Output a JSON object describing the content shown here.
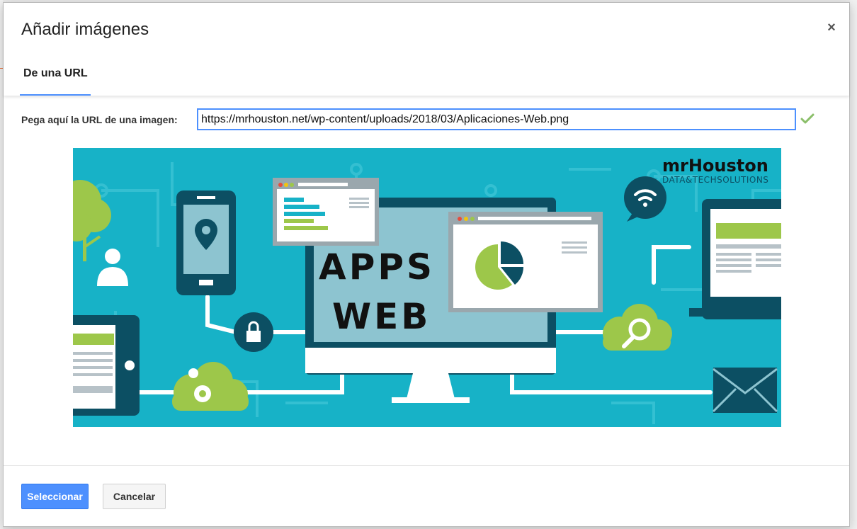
{
  "dialog": {
    "title": "Añadir imágenes",
    "close_label": "×",
    "tabs": [
      {
        "label": "De una URL",
        "active": true
      }
    ]
  },
  "url_field": {
    "label": "Pega aquí la URL de una imagen:",
    "value": "https://mrhouston.net/wp-content/uploads/2018/03/Aplicaciones-Web.png",
    "valid_icon": "checkmark-icon"
  },
  "preview": {
    "headline_line1": "APPS",
    "headline_line2": "WEB",
    "brand_logo": "mrHouston",
    "brand_tagline": "DATA&TECHSOLUTIONS",
    "bg_color": "#17b2c7",
    "accent_color": "#9dc74a",
    "dark_color": "#0c4f63"
  },
  "footer": {
    "select_label": "Seleccionar",
    "cancel_label": "Cancelar"
  },
  "colors": {
    "primary": "#4d90fe",
    "check": "#7cb342"
  }
}
